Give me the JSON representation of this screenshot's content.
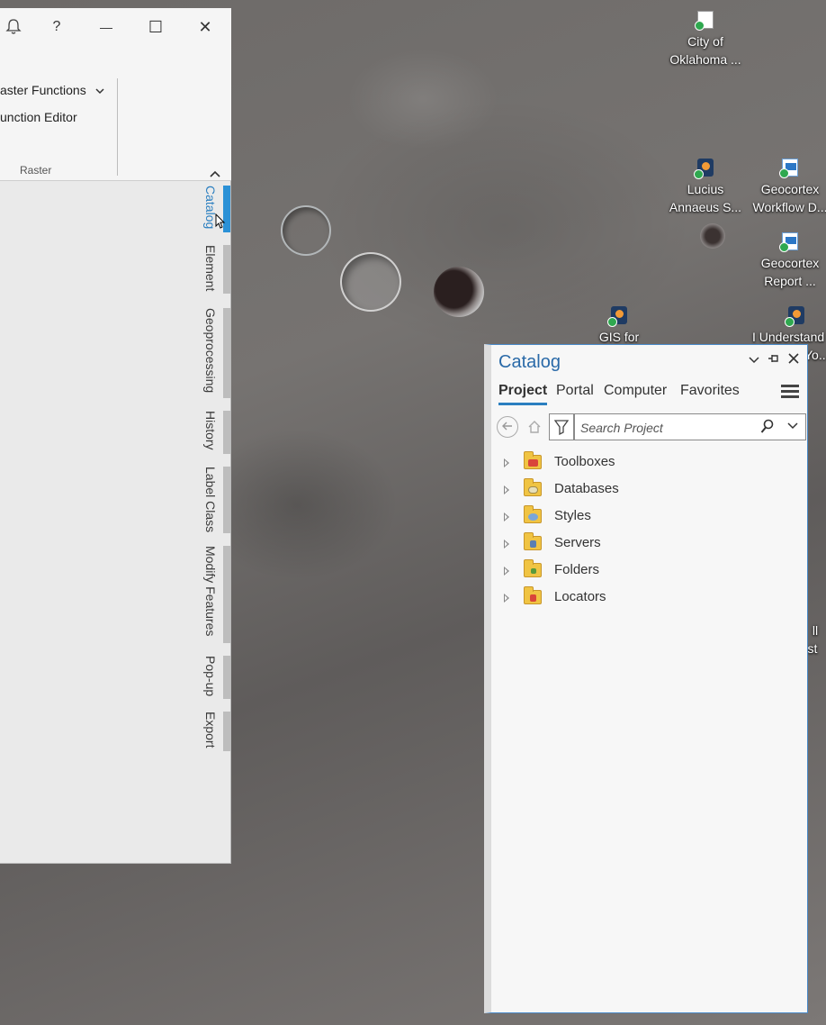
{
  "desktop": {
    "icons": [
      {
        "name": "doc",
        "line1": "City of",
        "line2": "Oklahoma ..."
      },
      {
        "name": "app",
        "line1": "Lucius",
        "line2": "Annaeus S..."
      },
      {
        "name": "web",
        "line1": "Geocortex",
        "line2": "Workflow D..."
      },
      {
        "name": "web",
        "line1": "Geocortex",
        "line2": "Report ..."
      },
      {
        "name": "app",
        "line1": "GIS for",
        "line2": ""
      },
      {
        "name": "app",
        "line1": "I Understand",
        "line2": "Yo..."
      },
      {
        "name": "partial",
        "line1": "ll",
        "line2": "st"
      }
    ]
  },
  "pro_window": {
    "titlebar": {
      "notifications_icon": "bell-icon",
      "help": "?",
      "minimize": "—",
      "maximize": "☐",
      "close": "✕"
    },
    "ribbon": {
      "raster_functions": "aster Functions",
      "function_editor": "unction Editor",
      "group_label": "Raster"
    },
    "side_tabs": [
      {
        "label": "Catalog",
        "active": true
      },
      {
        "label": "Element",
        "active": false
      },
      {
        "label": "Geoprocessing",
        "active": false
      },
      {
        "label": "History",
        "active": false
      },
      {
        "label": "Label Class",
        "active": false
      },
      {
        "label": "Modify Features",
        "active": false
      },
      {
        "label": "Pop-up",
        "active": false
      },
      {
        "label": "Export",
        "active": false
      }
    ]
  },
  "catalog": {
    "title": "Catalog",
    "tabs": [
      "Project",
      "Portal",
      "Computer",
      "Favorites"
    ],
    "active_tab": "Project",
    "search": {
      "placeholder": "Search Project",
      "value": ""
    },
    "items": [
      {
        "label": "Toolboxes",
        "icon": "toolbox-icon",
        "mark_color": "#d9453a"
      },
      {
        "label": "Databases",
        "icon": "database-icon",
        "mark_color": "#e7dfb9"
      },
      {
        "label": "Styles",
        "icon": "styles-icon",
        "mark_color": "#7aa6d8"
      },
      {
        "label": "Servers",
        "icon": "servers-icon",
        "mark_color": "#5a7fb1"
      },
      {
        "label": "Folders",
        "icon": "folders-icon",
        "mark_color": "#f0c443"
      },
      {
        "label": "Locators",
        "icon": "locators-icon",
        "mark_color": "#d9453a"
      }
    ]
  },
  "colors": {
    "accent": "#2b7fc0",
    "catalog_title": "#2a6aa8",
    "active_tab_bar": "#2b91d6"
  }
}
